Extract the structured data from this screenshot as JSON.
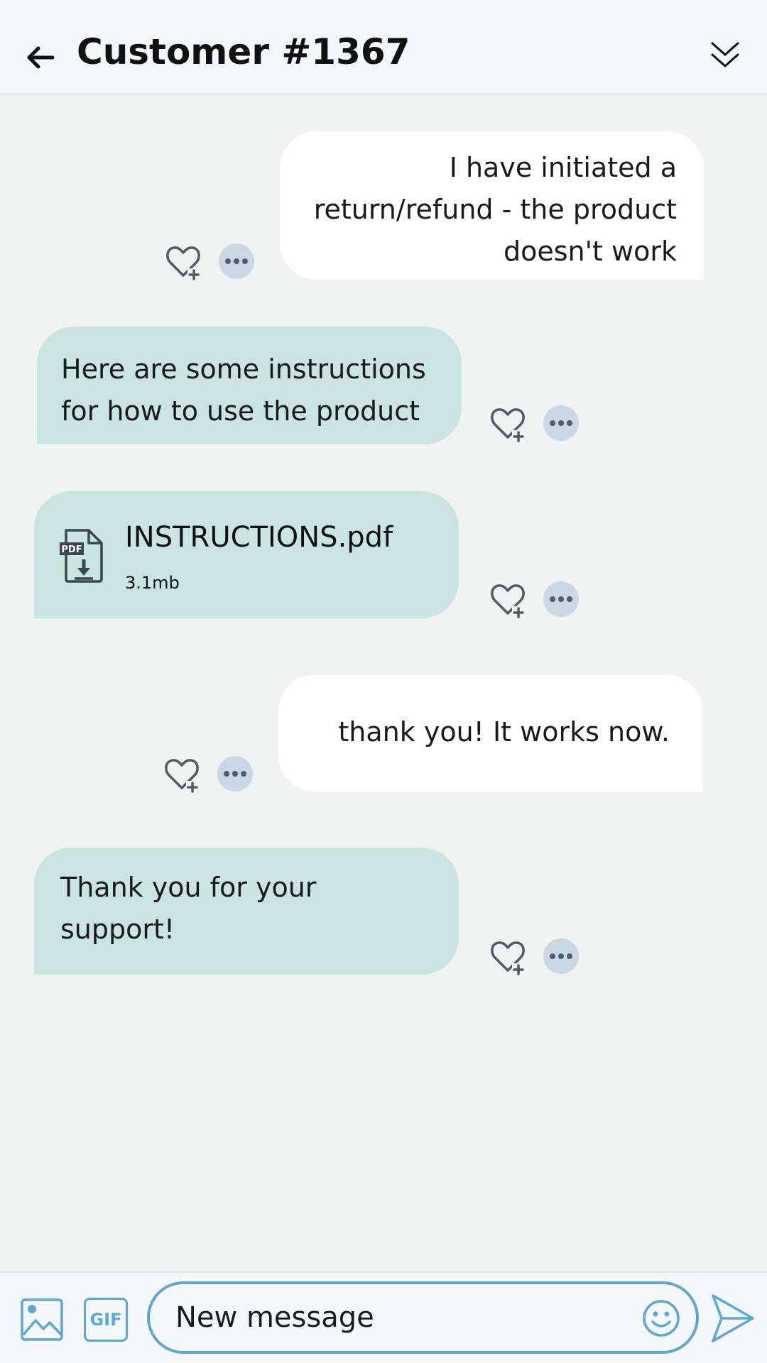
{
  "header": {
    "title": "Customer #1367"
  },
  "messages": [
    {
      "direction": "outgoing",
      "text": "I have initiated a\nreturn/refund - the product\ndoesn't work"
    },
    {
      "direction": "incoming",
      "text": "Here are some instructions\nfor how to use the product"
    },
    {
      "direction": "incoming",
      "type": "file",
      "file_name": "INSTRUCTIONS.pdf",
      "file_size": "3.1mb",
      "file_badge": "PDF"
    },
    {
      "direction": "outgoing",
      "text": "thank you! It works now."
    },
    {
      "direction": "incoming",
      "text": "Thank you for your\nsupport!"
    }
  ],
  "composer": {
    "gif_label": "GIF",
    "placeholder": "New message"
  },
  "icons": {
    "back": "arrow-left-icon",
    "collapse": "double-chevron-down-icon",
    "react": "heart-plus-icon",
    "more": "more-dots-icon",
    "file": "pdf-download-icon",
    "image": "image-icon",
    "emoji": "smiley-icon",
    "send": "send-icon"
  },
  "colors": {
    "incoming_bubble": "#c9e4e1",
    "outgoing_bubble": "#ffffff",
    "accent": "#5ba8d6",
    "background": "#f1f2f2",
    "more_button": "#c9d8e4",
    "icon_gray": "#4f5b66"
  }
}
